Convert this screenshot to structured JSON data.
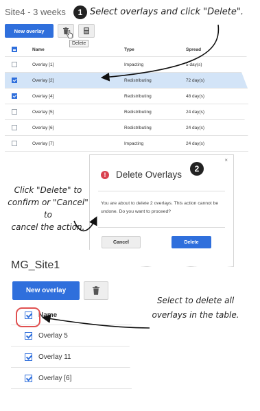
{
  "panel1": {
    "title": "Site4 - 3 weeks",
    "new_overlay_label": "New overlay",
    "delete_tooltip": "Delete",
    "columns": {
      "name": "Name",
      "type": "Type",
      "spread": "Spread"
    },
    "rows": [
      {
        "name": "Overlay [1]",
        "type": "Impacting",
        "spread": "5 day(s)",
        "checked": false
      },
      {
        "name": "Overlay [2]",
        "type": "Redistributing",
        "spread": "72 day(s)",
        "checked": true
      },
      {
        "name": "Overlay [4]",
        "type": "Redistributing",
        "spread": "48 day(s)",
        "checked": true
      },
      {
        "name": "Overlay [5]",
        "type": "Redistributing",
        "spread": "24 day(s)",
        "checked": false
      },
      {
        "name": "Overlay [6]",
        "type": "Redistributing",
        "spread": "24 day(s)",
        "checked": false
      },
      {
        "name": "Overlay [7]",
        "type": "Impacting",
        "spread": "24 day(s)",
        "checked": false
      }
    ]
  },
  "annotations": {
    "step1": "1",
    "step2": "2",
    "callout1": "Select overlays and click \"Delete\".",
    "callout2_lines": [
      "Click \"Delete\" to",
      "confirm or \"Cancel\" to",
      "cancel the action."
    ],
    "callout3_lines": [
      "Select to delete all",
      "overlays in the table."
    ]
  },
  "dialog": {
    "close_label": "×",
    "title": "Delete Overlays",
    "message": "You are about to delete 2 overlays. This action cannot be undone. Do you want to proceed?",
    "cancel_label": "Cancel",
    "delete_label": "Delete"
  },
  "panel3": {
    "title": "MG_Site1",
    "new_overlay_label": "New overlay",
    "column_name": "Name",
    "rows": [
      {
        "name": "Overlay 5",
        "checked": true
      },
      {
        "name": "Overlay 11",
        "checked": true
      },
      {
        "name": "Overlay [6]",
        "checked": true
      }
    ]
  },
  "colors": {
    "accent": "#2f6fdc",
    "selected_row": "#d3e4f7",
    "warning": "#d9414f",
    "highlight_ring": "#e05050"
  }
}
